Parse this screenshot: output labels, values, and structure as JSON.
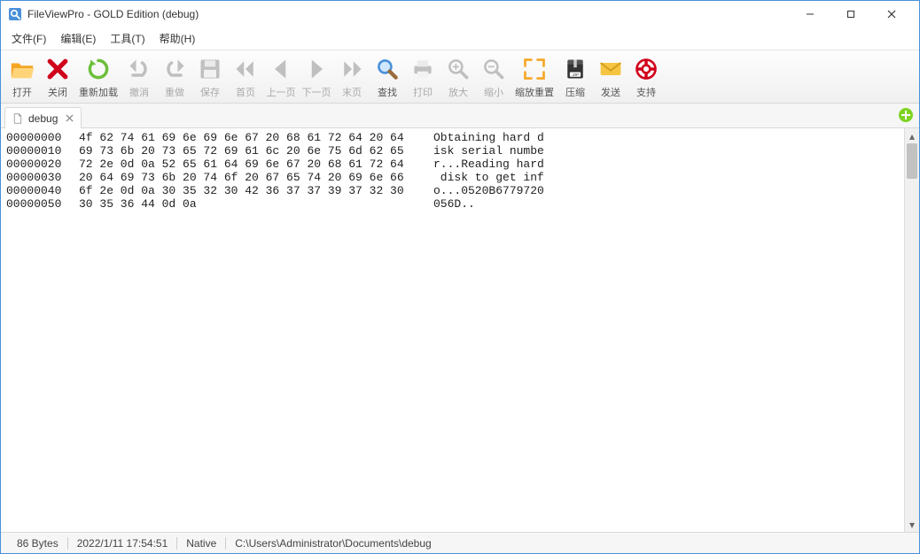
{
  "window": {
    "title": "FileViewPro - GOLD Edition (debug)"
  },
  "menu": {
    "file": "文件(F)",
    "edit": "编辑(E)",
    "tools": "工具(T)",
    "help": "帮助(H)"
  },
  "toolbar": {
    "open": "打开",
    "close": "关闭",
    "reload": "重新加载",
    "undo": "撤消",
    "redo": "重做",
    "save": "保存",
    "first": "首页",
    "prev": "上一页",
    "next": "下一页",
    "last": "末页",
    "find": "查找",
    "print": "打印",
    "zoomin": "放大",
    "zoomout": "缩小",
    "zoomreset": "缩放重置",
    "zip": "压缩",
    "send": "发送",
    "support": "支持"
  },
  "tab": {
    "label": "debug"
  },
  "hex": {
    "rows": [
      {
        "offset": "00000000",
        "bytes": "4f 62 74 61 69 6e 69 6e 67 20 68 61 72 64 20 64",
        "ascii": "Obtaining hard d"
      },
      {
        "offset": "00000010",
        "bytes": "69 73 6b 20 73 65 72 69 61 6c 20 6e 75 6d 62 65",
        "ascii": "isk serial numbe"
      },
      {
        "offset": "00000020",
        "bytes": "72 2e 0d 0a 52 65 61 64 69 6e 67 20 68 61 72 64",
        "ascii": "r...Reading hard"
      },
      {
        "offset": "00000030",
        "bytes": "20 64 69 73 6b 20 74 6f 20 67 65 74 20 69 6e 66",
        "ascii": " disk to get inf"
      },
      {
        "offset": "00000040",
        "bytes": "6f 2e 0d 0a 30 35 32 30 42 36 37 37 39 37 32 30",
        "ascii": "o...0520B6779720"
      },
      {
        "offset": "00000050",
        "bytes": "30 35 36 44 0d 0a",
        "ascii": "056D.."
      }
    ]
  },
  "status": {
    "size": "86 Bytes",
    "time": "2022/1/11 17:54:51",
    "mode": "Native",
    "path": "C:\\Users\\Administrator\\Documents\\debug"
  },
  "colors": {
    "accent": "#4a90d9",
    "brand_orange": "#f5a623",
    "brand_red": "#d0021b",
    "brand_green": "#7ed321"
  }
}
